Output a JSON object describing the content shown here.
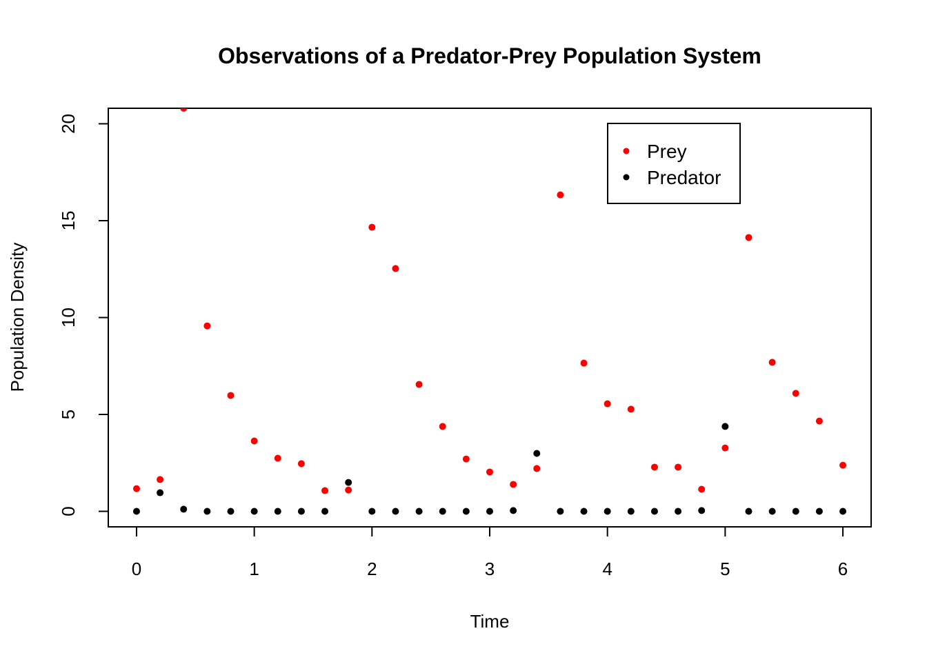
{
  "chart_data": {
    "type": "scatter",
    "title": "Observations of a Predator-Prey Population System",
    "xlabel": "Time",
    "ylabel": "Population Density",
    "xlim": [
      -0.24,
      6.24
    ],
    "ylim": [
      -0.8,
      20.8
    ],
    "xticks": [
      0,
      1,
      2,
      3,
      4,
      5,
      6
    ],
    "yticks": [
      0,
      5,
      10,
      15,
      20
    ],
    "grid": false,
    "legend_position": "top-right",
    "x": [
      0.0,
      0.2,
      0.4,
      0.6,
      0.8,
      1.0,
      1.2,
      1.4,
      1.6,
      1.8,
      2.0,
      2.2,
      2.4,
      2.6,
      2.8,
      3.0,
      3.2,
      3.4,
      3.6,
      3.8,
      4.0,
      4.2,
      4.4,
      4.6,
      4.8,
      5.0,
      5.2,
      5.4,
      5.6,
      5.8,
      6.0
    ],
    "series": [
      {
        "name": "Prey",
        "color": "#ff0000",
        "values": [
          1.17,
          1.64,
          20.8,
          9.57,
          5.98,
          3.63,
          2.74,
          2.46,
          1.07,
          1.1,
          14.66,
          12.53,
          6.55,
          4.38,
          2.7,
          2.03,
          1.39,
          2.21,
          16.33,
          7.65,
          5.55,
          5.27,
          2.28,
          2.28,
          1.14,
          3.27,
          14.13,
          7.69,
          6.09,
          4.66,
          2.38
        ]
      },
      {
        "name": "Predator",
        "color": "#000000",
        "values": [
          0.0,
          0.96,
          0.11,
          0.0,
          0.0,
          0.0,
          0.0,
          0.0,
          0.0,
          1.49,
          0.0,
          0.0,
          0.0,
          0.0,
          0.0,
          0.0,
          0.04,
          2.99,
          0.0,
          0.0,
          0.0,
          0.0,
          0.0,
          0.0,
          0.04,
          4.38,
          0.0,
          0.0,
          0.0,
          0.0,
          0.0
        ]
      }
    ]
  }
}
